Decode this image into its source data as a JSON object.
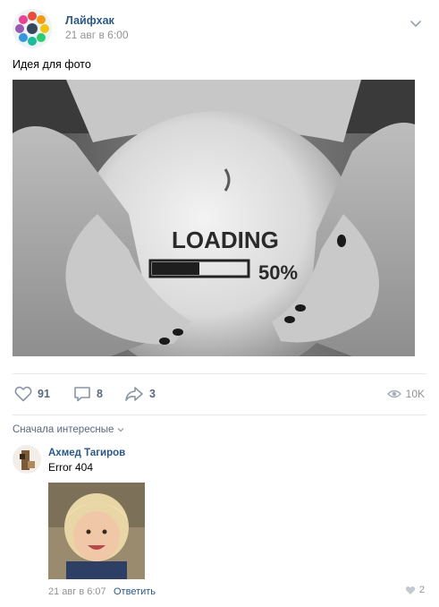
{
  "post": {
    "group_name": "Лайфхак",
    "date": "21 авг в 6:00",
    "text": "Идея для фото",
    "photo": {
      "belly_text": "LOADING",
      "progress_text": "50%",
      "progress_fraction": 0.5
    }
  },
  "actions": {
    "likes": "91",
    "comments": "8",
    "shares": "3",
    "views": "10K"
  },
  "comments_section": {
    "sort_label": "Сначала интересные"
  },
  "comment": {
    "author": "Ахмед Тагиров",
    "text": "Error 404",
    "date": "21 авг в 6:07",
    "reply_label": "Ответить",
    "likes": "2"
  },
  "icons": {
    "menu": "chevron-down-icon",
    "like": "heart-icon",
    "comment": "comment-icon",
    "share": "share-icon",
    "views": "eye-icon",
    "sort": "chevron-down-icon"
  },
  "colors": {
    "link": "#2a5885",
    "muted": "#939393",
    "action": "#5a6a7e",
    "divider": "#e7e8ec"
  }
}
